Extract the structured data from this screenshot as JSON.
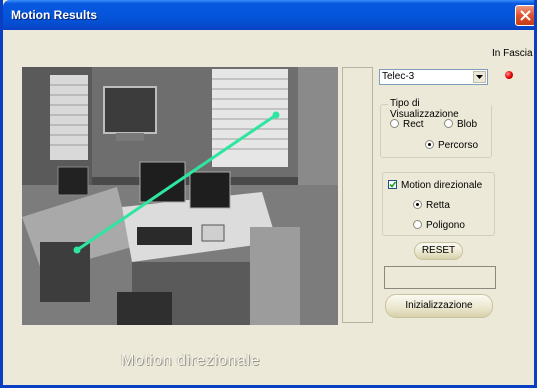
{
  "window": {
    "title": "Motion Results",
    "close_icon": "close-icon"
  },
  "status": {
    "label": "In Fascia",
    "indicator_color": "#e00000"
  },
  "camera_select": {
    "value": "Telec-3"
  },
  "visualization_group": {
    "title": "Tipo di Visualizzazione",
    "options": [
      {
        "label": "Rect",
        "checked": false
      },
      {
        "label": "Blob",
        "checked": false
      },
      {
        "label": "Percorso",
        "checked": true
      }
    ]
  },
  "motion_group": {
    "checkbox_label": "Motion direzionale",
    "checkbox_checked": true,
    "options": [
      {
        "label": "Retta",
        "checked": true
      },
      {
        "label": "Poligono",
        "checked": false
      }
    ]
  },
  "buttons": {
    "reset": "RESET",
    "init": "Inizializzazione"
  },
  "footer": {
    "mode_text": "Motion direzionale"
  },
  "colors": {
    "track_line": "#2de6a0",
    "title_bar": "#0556dc"
  }
}
